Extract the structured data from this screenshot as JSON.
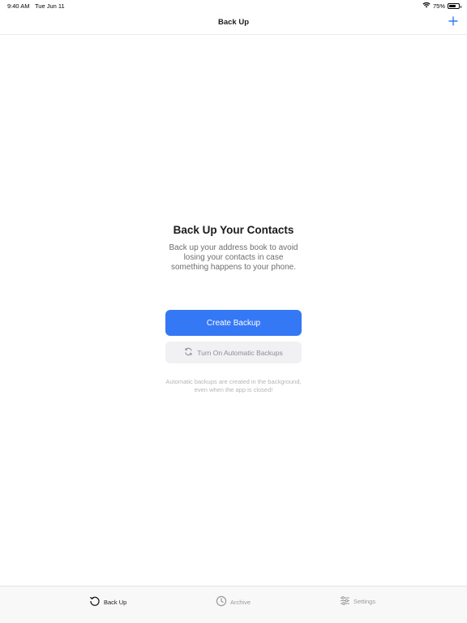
{
  "status_bar": {
    "time": "9:40 AM",
    "date": "Tue Jun 11",
    "battery": "75%",
    "battery_level": 0.75
  },
  "nav": {
    "title": "Back Up",
    "add_icon": "plus-icon"
  },
  "empty_state": {
    "title": "Back Up Your Contacts",
    "description": "Back up your address book to avoid losing your contacts in case something happens to your phone."
  },
  "actions": {
    "create_backup": "Create Backup",
    "auto_backup": "Turn On Automatic Backups",
    "auto_backup_icon": "refresh-icon"
  },
  "footnote": "Automatic backups are created in the background, even when the app is closed!",
  "tabs": [
    {
      "label": "Back Up",
      "icon": "history-icon",
      "active": true
    },
    {
      "label": "Archive",
      "icon": "clock-icon",
      "active": false
    },
    {
      "label": "Settings",
      "icon": "sliders-icon",
      "active": false
    }
  ],
  "colors": {
    "accent": "#3478f6",
    "secondary_bg": "#f1f1f3",
    "muted_text": "#8e8e93"
  }
}
